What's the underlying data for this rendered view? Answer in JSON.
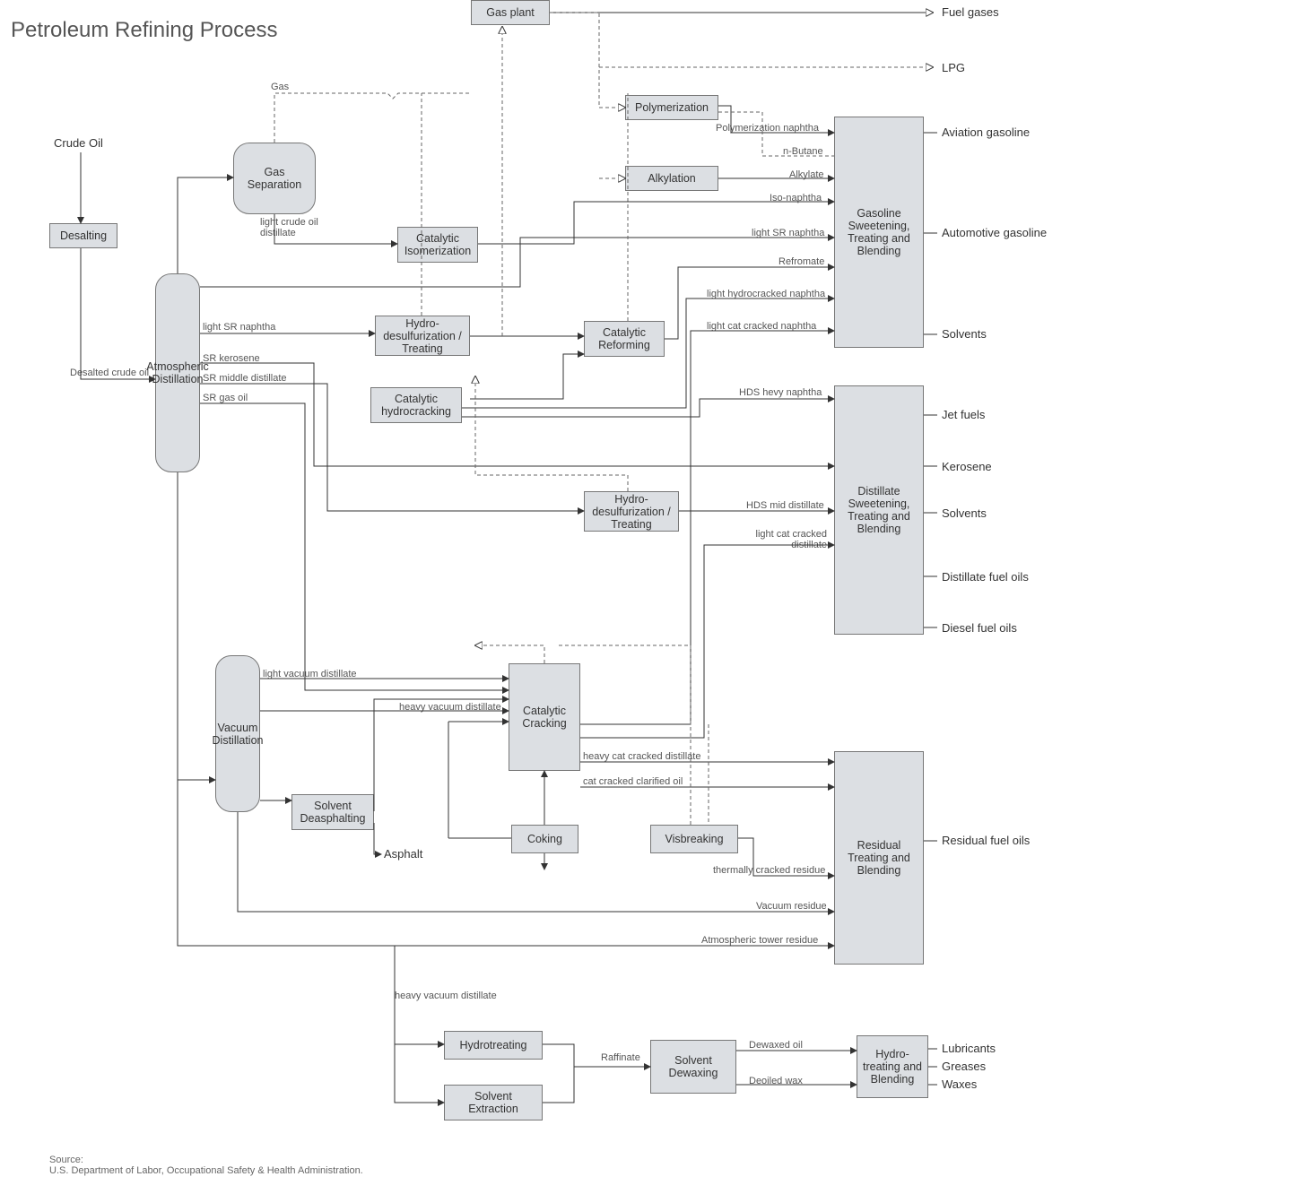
{
  "title": "Petroleum Refining Process",
  "source": "Source:\nU.S. Department of Labor, Occupational Safety & Health Administration.",
  "input": "Crude Oil",
  "boxes": {
    "desalting": "Desalting",
    "gas_sep": "Gas Separation",
    "atmos": "Atmospheric Distillation",
    "vacuum": "Vacuum Distillation",
    "gas_plant": "Gas plant",
    "poly": "Polymerization",
    "alkyl": "Alkylation",
    "cat_isom": "Catalytic Isomerization",
    "hydro_ds1": "Hydro-desulfurization / Treating",
    "cat_reform": "Catalytic Reforming",
    "cat_hydro": "Catalytic hydrocracking",
    "hydro_ds2": "Hydro-desulfurization / Treating",
    "cat_crack": "Catalytic Cracking",
    "solv_deasph": "Solvent Deasphalting",
    "coking": "Coking",
    "visbreak": "Visbreaking",
    "hydrotreat": "Hydrotreating",
    "solv_extract": "Solvent Extraction",
    "solv_dewax": "Solvent Dewaxing",
    "hydrotreat_blend": "Hydro-treating and Blending",
    "gaso_blend": "Gasoline Sweetening, Treating and Blending",
    "dist_blend": "Distillate Sweetening, Treating and Blending",
    "resid_blend": "Residual Treating and Blending"
  },
  "streams": {
    "gas": "Gas",
    "light_crude": "light crude oil distillate",
    "desalted": "Desalted crude oil",
    "light_sr_naphtha": "light SR naphtha",
    "sr_kerosene": "SR kerosene",
    "sr_mid": "SR middle distillate",
    "sr_gas_oil": "SR gas oil",
    "light_vac": "light vacuum distillate",
    "heavy_vac": "heavy vacuum distillate",
    "heavy_vac2": "heavy vacuum distillate",
    "asphalt": "Asphalt",
    "raffinate": "Raffinate",
    "dewaxed": "Dewaxed oil",
    "deoiled": "Deoiled wax",
    "poly_naphtha": "Polymerization naphtha",
    "n_butane": "n-Butane",
    "alkylate": "Alkylate",
    "iso_naphtha": "Iso-naphtha",
    "light_sr_naphtha2": "light SR naphtha",
    "refromate": "Refromate",
    "light_hydro_naphtha": "light hydrocracked naphtha",
    "light_cat_naphtha": "light cat cracked naphtha",
    "hds_heavy_naphtha": "HDS hevy naphtha",
    "hds_mid": "HDS mid distillate",
    "light_cat_dist": "light cat cracked distillate",
    "heavy_cat_dist": "heavy cat cracked distillate",
    "cat_clarified": "cat cracked clarified oil",
    "therm_residue": "thermally cracked residue",
    "vac_residue": "Vacuum residue",
    "atmos_residue": "Atmospheric tower residue"
  },
  "outputs": {
    "fuel_gases": "Fuel gases",
    "lpg": "LPG",
    "av_gaso": "Aviation gasoline",
    "auto_gaso": "Automotive gasoline",
    "solvents1": "Solvents",
    "jet": "Jet fuels",
    "kerosene": "Kerosene",
    "solvents2": "Solvents",
    "dist_fuel": "Distillate fuel oils",
    "diesel": "Diesel fuel oils",
    "resid_fuel": "Residual fuel oils",
    "lubricants": "Lubricants",
    "greases": "Greases",
    "waxes": "Waxes"
  }
}
